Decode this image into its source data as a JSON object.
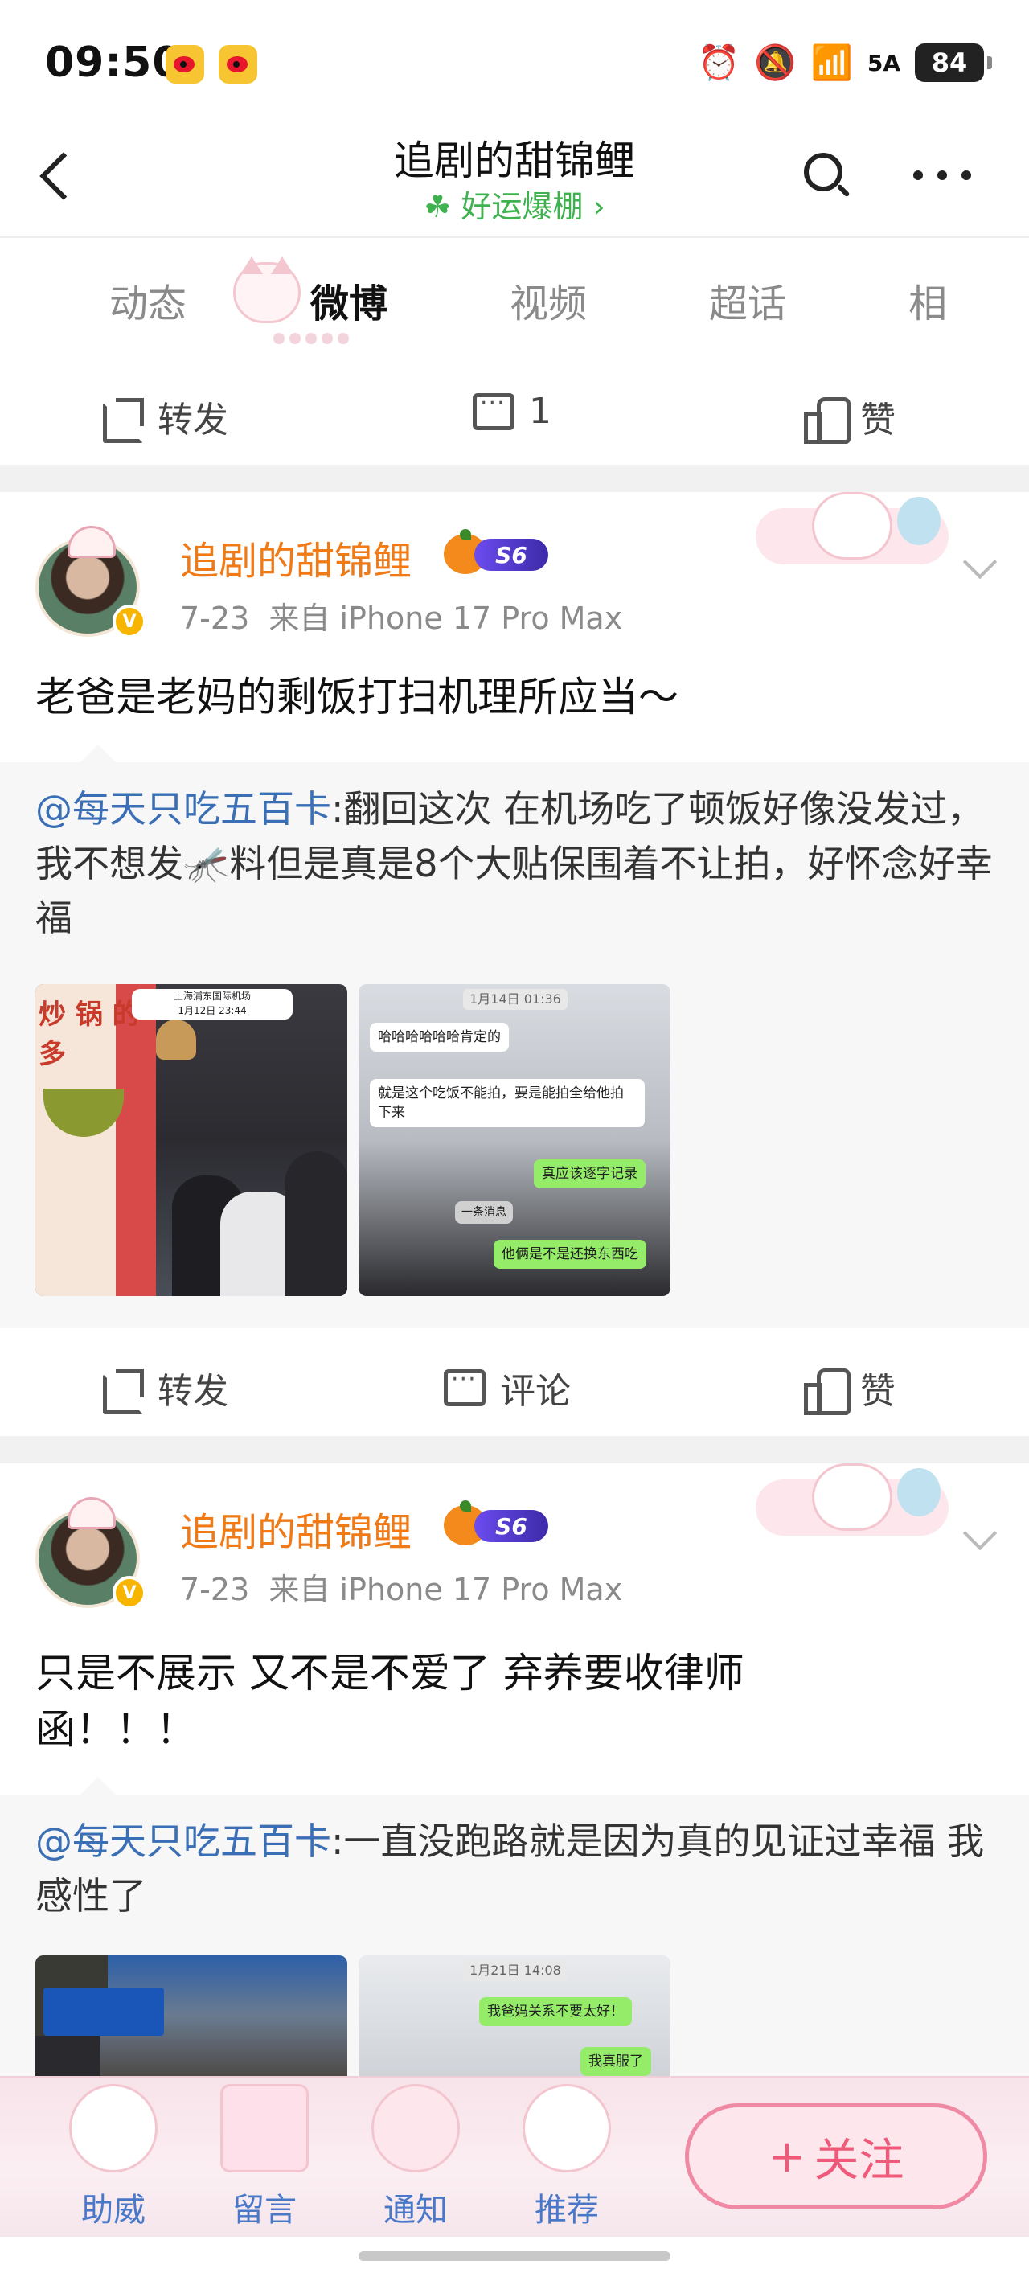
{
  "status_bar": {
    "time": "09:50",
    "network": "5A",
    "battery": "84",
    "app_icons": [
      "weibo-icon",
      "weibo-icon"
    ]
  },
  "header": {
    "title": "追剧的甜锦鲤",
    "subtitle": "好运爆棚",
    "subtitle_icon": "clover-icon",
    "subtitle_arrow": "›"
  },
  "tabs": [
    {
      "label": "动态"
    },
    {
      "label": "微博",
      "active": true
    },
    {
      "label": "视频"
    },
    {
      "label": "超话"
    },
    {
      "label": "相"
    }
  ],
  "top_actions": {
    "repost": "转发",
    "comment": "1",
    "like": "赞"
  },
  "posts": [
    {
      "author": "追剧的甜锦鲤",
      "level": "S6",
      "date": "7-23",
      "source": "来自 iPhone 17 Pro Max",
      "text": "老爸是老妈的剩饭打扫机理所应当～",
      "repost": {
        "mention": "@每天只吃五百卡",
        "text": ":翻回这次 在机场吃了顿饭好像没发过，我不想发🦟料但是真是8个大贴保围着不让拍，好怀念好幸福",
        "image_1": {
          "poster_text": "炒 锅 的 多",
          "caption_1": "上海浦东国际机场",
          "caption_2": "1月12日 23:44"
        },
        "image_2": {
          "timestamp": "1月14日 01:36",
          "messages": [
            "哈哈哈哈哈哈肯定的",
            "就是这个吃饭不能拍，要是能拍全给他拍下来",
            "真应该逐字记录",
            "一条消息",
            "他俩是不是还换东西吃"
          ]
        }
      },
      "actions": {
        "repost": "转发",
        "comment": "评论",
        "like": "赞"
      }
    },
    {
      "author": "追剧的甜锦鲤",
      "level": "S6",
      "date": "7-23",
      "source": "来自 iPhone 17 Pro Max",
      "text": "只是不展示 又不是不爱了 弃养要收律师函！！！",
      "repost": {
        "mention": "@每天只吃五百卡",
        "text": ":一直没跑路就是因为真的见证过幸福 我感性了",
        "image_2": {
          "timestamp": "1月21日 14:08",
          "messages": [
            "我爸妈关系不要太好！",
            "我真服了"
          ]
        }
      }
    }
  ],
  "bottom_bar": {
    "items": [
      {
        "label": "助威"
      },
      {
        "label": "留言"
      },
      {
        "label": "通知"
      },
      {
        "label": "推荐"
      }
    ],
    "follow": {
      "plus": "+",
      "label": "关注"
    }
  },
  "colors": {
    "accent_orange": "#f07a16",
    "mention_blue": "#3b6fb5",
    "clover_green": "#3fb24f",
    "follow_pink": "#f05a7a"
  }
}
